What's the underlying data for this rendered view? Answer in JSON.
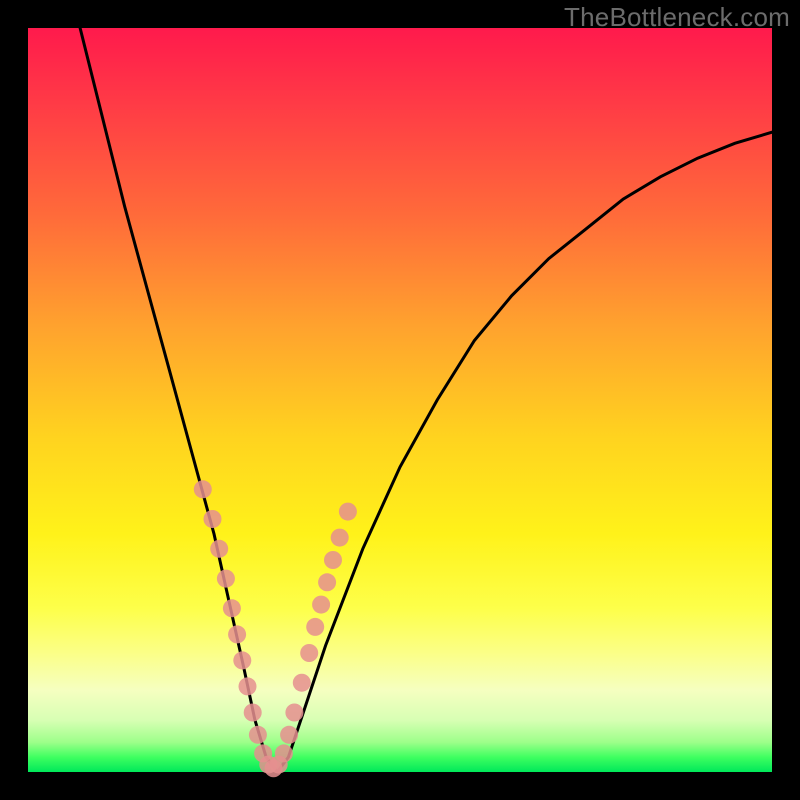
{
  "watermark": "TheBottleneck.com",
  "chart_data": {
    "type": "line",
    "title": "",
    "xlabel": "",
    "ylabel": "",
    "xlim": [
      0,
      100
    ],
    "ylim": [
      0,
      100
    ],
    "grid": false,
    "series": [
      {
        "name": "curve",
        "color": "#000000",
        "x": [
          7,
          10,
          13,
          16,
          19,
          22,
          25,
          27,
          29,
          30.5,
          32,
          33.5,
          35,
          37,
          40,
          45,
          50,
          55,
          60,
          65,
          70,
          75,
          80,
          85,
          90,
          95,
          100
        ],
        "y": [
          100,
          88,
          76,
          65,
          54,
          43,
          32,
          23,
          14,
          7,
          2,
          0,
          2,
          8,
          17,
          30,
          41,
          50,
          58,
          64,
          69,
          73,
          77,
          80,
          82.5,
          84.5,
          86
        ]
      },
      {
        "name": "dots",
        "color": "#e58f8f",
        "x": [
          23.5,
          24.8,
          25.7,
          26.6,
          27.4,
          28.1,
          28.8,
          29.5,
          30.2,
          30.9,
          31.6,
          32.3,
          33.0,
          33.7,
          34.4,
          35.1,
          35.8,
          36.8,
          37.8,
          38.6,
          39.4,
          40.2,
          41.0,
          41.9,
          43.0
        ],
        "y": [
          38,
          34,
          30,
          26,
          22,
          18.5,
          15,
          11.5,
          8,
          5,
          2.5,
          1,
          0.5,
          1,
          2.5,
          5,
          8,
          12,
          16,
          19.5,
          22.5,
          25.5,
          28.5,
          31.5,
          35
        ]
      }
    ],
    "gradient_background": {
      "top": "#ff1a4c",
      "mid": "#ffd31f",
      "bottom": "#00e85a"
    }
  }
}
